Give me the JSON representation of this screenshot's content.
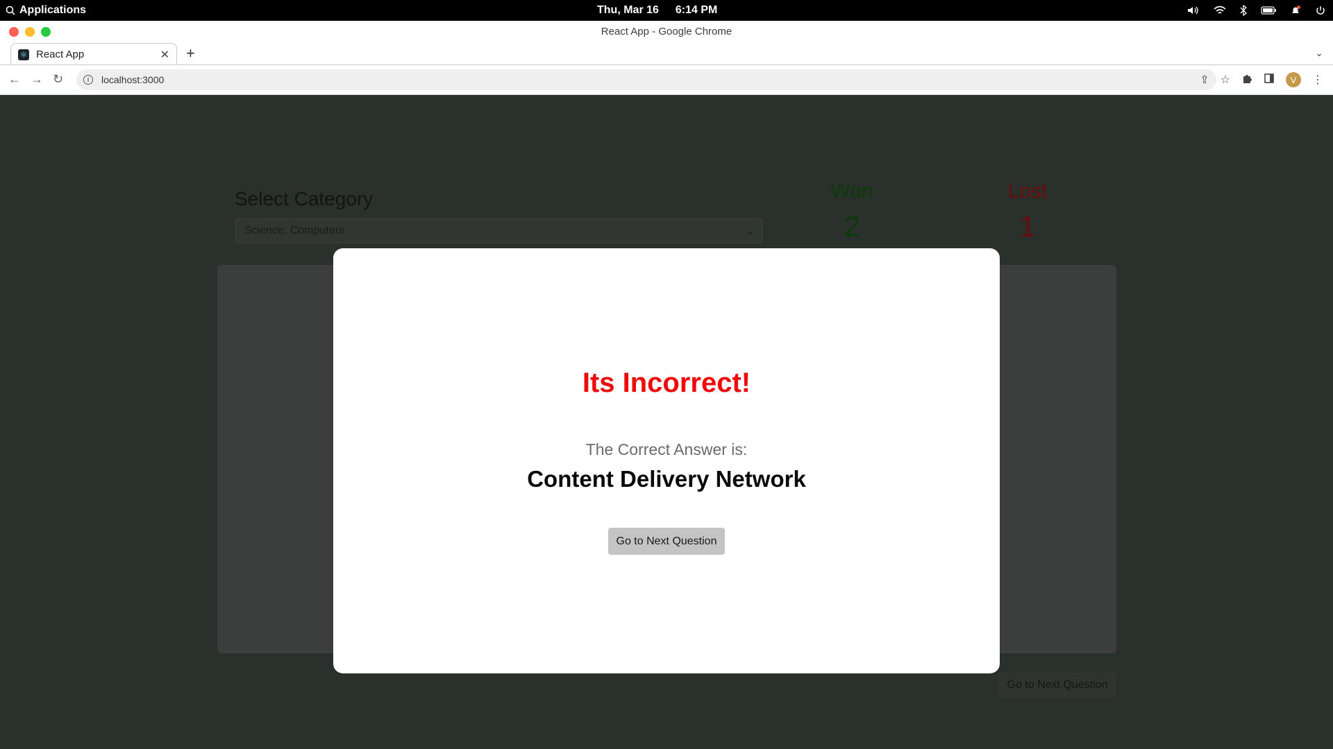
{
  "os_bar": {
    "apps_label": "Applications",
    "date": "Thu, Mar 16",
    "time": "6:14 PM"
  },
  "browser": {
    "window_title": "React App - Google Chrome",
    "tab_title": "React App",
    "url": "localhost:3000",
    "profile_initial": "V"
  },
  "app": {
    "category_label": "Select Category",
    "selected_category": "Science: Computers",
    "won_label": "Won",
    "won_count": "2",
    "lost_label": "Lost",
    "lost_count": "1",
    "next_button_label": "Go to Next Question"
  },
  "modal": {
    "title": "Its Incorrect!",
    "subtitle": "The Correct Answer is:",
    "answer": "Content Delivery Network",
    "button_label": "Go to Next Question"
  },
  "colors": {
    "incorrect_title": "#ee0b0b",
    "won": "#0b3a0b",
    "lost": "#6b0d0d",
    "overlay_bg": "#2a302b"
  }
}
